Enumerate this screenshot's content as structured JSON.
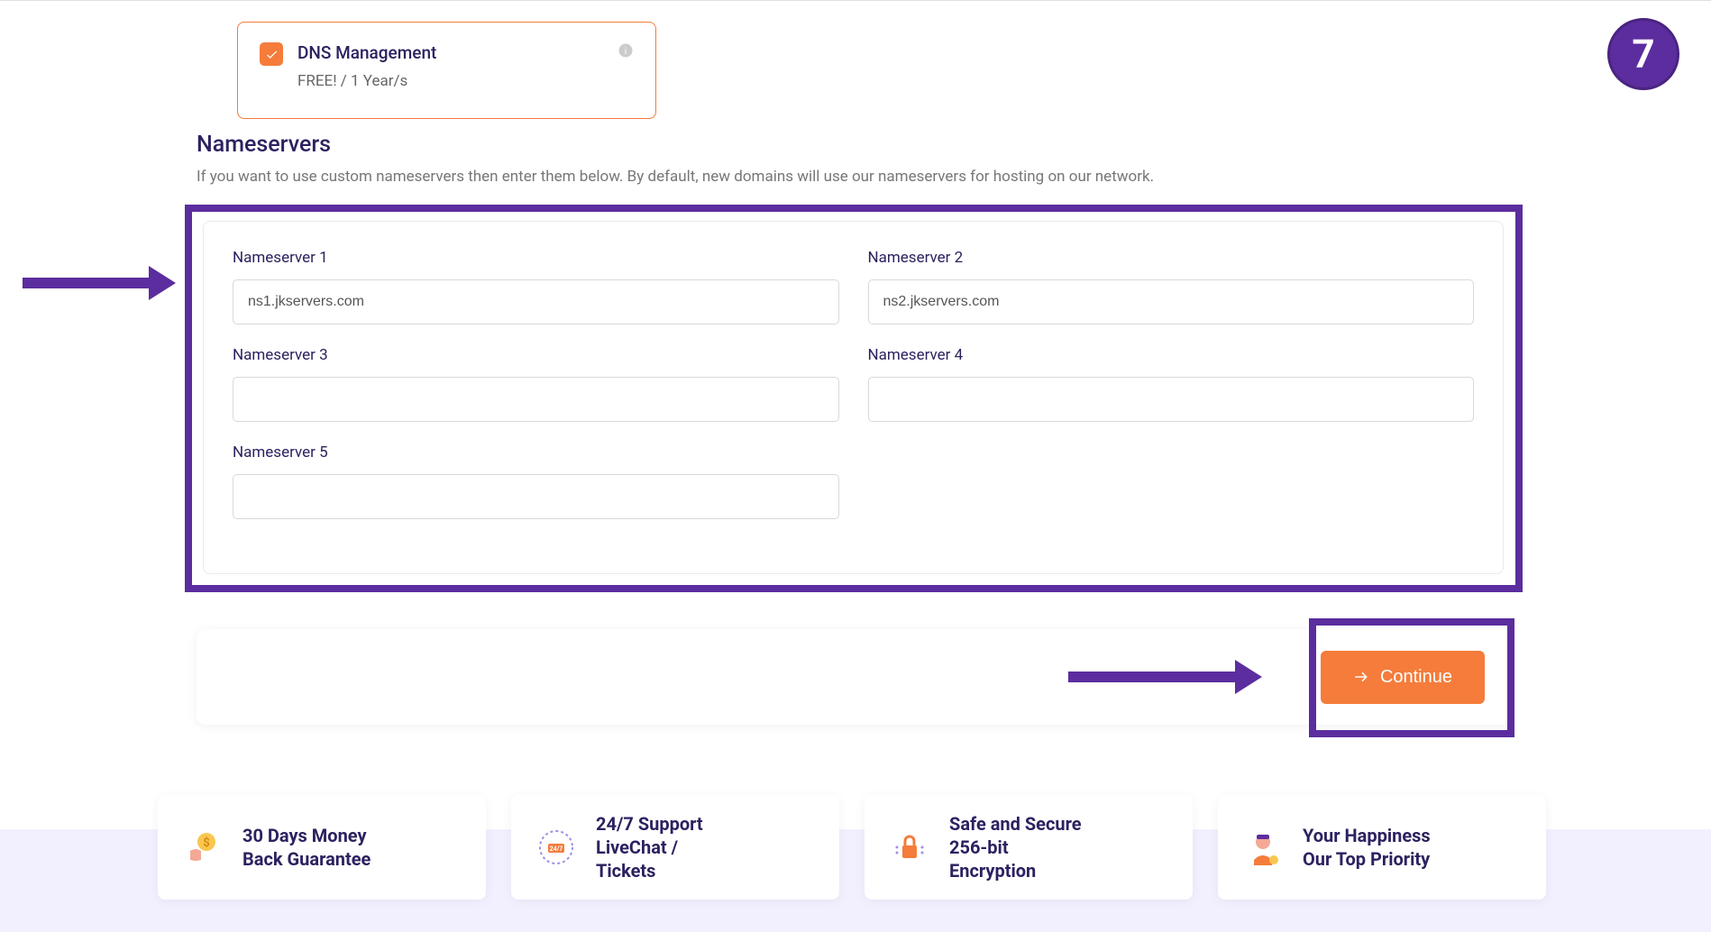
{
  "badge": "7",
  "addon": {
    "title": "DNS Management",
    "price": "FREE! / 1 Year/s"
  },
  "nameservers": {
    "heading": "Nameservers",
    "description": "If you want to use custom nameservers then enter them below. By default, new domains will use our nameservers for hosting on our network.",
    "fields": {
      "ns1": {
        "label": "Nameserver 1",
        "value": "ns1.jkservers.com"
      },
      "ns2": {
        "label": "Nameserver 2",
        "value": "ns2.jkservers.com"
      },
      "ns3": {
        "label": "Nameserver 3",
        "value": ""
      },
      "ns4": {
        "label": "Nameserver 4",
        "value": ""
      },
      "ns5": {
        "label": "Nameserver 5",
        "value": ""
      }
    }
  },
  "continue_label": "Continue",
  "features": [
    {
      "line1": "30 Days Money",
      "line2": "Back Guarantee"
    },
    {
      "line1": "24/7 Support",
      "line2": "LiveChat /",
      "line3": "Tickets"
    },
    {
      "line1": "Safe and Secure",
      "line2": "256-bit",
      "line3": "Encryption"
    },
    {
      "line1": "Your Happiness",
      "line2": "Our Top Priority"
    }
  ]
}
